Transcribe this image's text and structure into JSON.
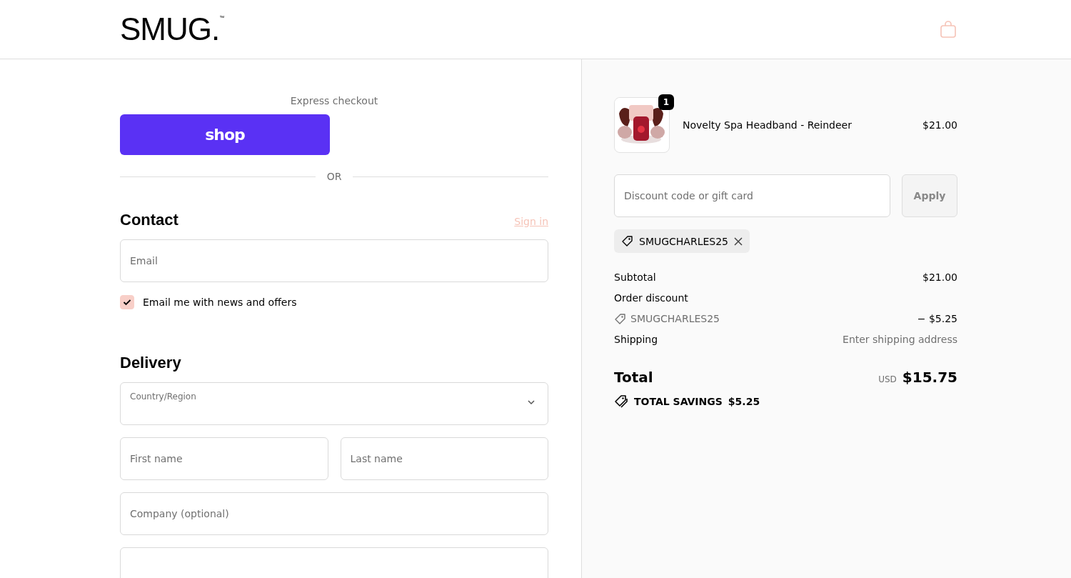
{
  "header": {
    "logo": "SMUG.",
    "logo_mark": "™"
  },
  "express": {
    "title": "Express checkout",
    "shop_button": "shop",
    "divider": "OR"
  },
  "contact": {
    "title": "Contact",
    "sign_in": "Sign in",
    "email": {
      "placeholder": "Email"
    },
    "newsletter": {
      "label": "Email me with news and offers",
      "checked": true
    }
  },
  "delivery": {
    "title": "Delivery",
    "rows": [
      [
        {
          "kind": "select",
          "label": "Country/Region"
        }
      ],
      [
        {
          "kind": "input",
          "placeholder": "First name"
        },
        {
          "kind": "input",
          "placeholder": "Last name"
        }
      ],
      [
        {
          "kind": "input",
          "placeholder": "Company (optional)"
        }
      ],
      [
        {
          "kind": "input"
        }
      ]
    ]
  },
  "summary": {
    "items": [
      {
        "kind": "picture",
        "quantity": "1",
        "name": "Novelty Spa Headband - Reindeer",
        "price": "$21.00"
      }
    ],
    "discount": {
      "placeholder": "Discount code or gift card",
      "apply": "Apply",
      "disabled": true
    },
    "applied_codes": [
      "SMUGCHARLES25"
    ],
    "lines": [
      {
        "kind": "plain",
        "label": "Subtotal",
        "value": "$21.00"
      },
      {
        "kind": "plain",
        "label": "Order discount"
      },
      {
        "kind": "code",
        "label": "SMUGCHARLES25",
        "value": "− $5.25"
      },
      {
        "kind": "muted",
        "label": "Shipping",
        "value": "Enter shipping address"
      }
    ],
    "total": {
      "label": "Total",
      "currency": "USD",
      "amount": "$15.75"
    },
    "savings": {
      "label": "TOTAL SAVINGS",
      "amount": "$5.25"
    }
  }
}
